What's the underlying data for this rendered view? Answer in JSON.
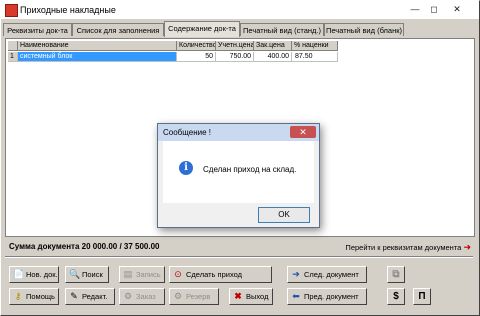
{
  "window": {
    "title": "Приходные накладные",
    "controls": {
      "minimize": "—",
      "maximize": "◻",
      "close": "✕"
    }
  },
  "tabs": [
    {
      "label": "Реквизиты док-та",
      "active": false
    },
    {
      "label": "Список для заполнения",
      "active": false
    },
    {
      "label": "Содержание док-та",
      "active": true
    },
    {
      "label": "Печатный вид (станд.)",
      "active": false
    },
    {
      "label": "Печатный вид (бланк)",
      "active": false
    }
  ],
  "table": {
    "columns": [
      "",
      "Наименование",
      "Количество",
      "Учетн.цена",
      "Зак.цена",
      "% наценки"
    ],
    "rows": [
      {
        "index": "1",
        "name": "системный блок",
        "qty": "50",
        "acct_price": "750.00",
        "purchase_price": "400.00",
        "markup": "87.50"
      }
    ]
  },
  "summary": {
    "total": "Сумма документа 20 000.00 / 37 500.00",
    "goto_link": "Перейти к реквизитам документа",
    "goto_icon": "arrow-right-icon"
  },
  "buttons": {
    "new_doc": "Нов. док.",
    "search": "Поиск",
    "save": "Запись",
    "make_receipt": "Сделать приход",
    "next_doc": "След. документ",
    "help": "Помощь",
    "edit": "Редакт.",
    "order": "Заказ",
    "reserve": "Резерв",
    "exit": "Выход",
    "prev_doc": "Пред. документ",
    "dollar": "$",
    "print": "П"
  },
  "dialog": {
    "title": "Сообщение !",
    "message": "Сделан приход на склад.",
    "ok": "OK",
    "close": "✕",
    "icon": "info-icon"
  },
  "colors": {
    "selection": "#3399ff",
    "window_bg": "#d4d0c8",
    "dialog_title": "#c9daf0",
    "close_red": "#c75050"
  }
}
